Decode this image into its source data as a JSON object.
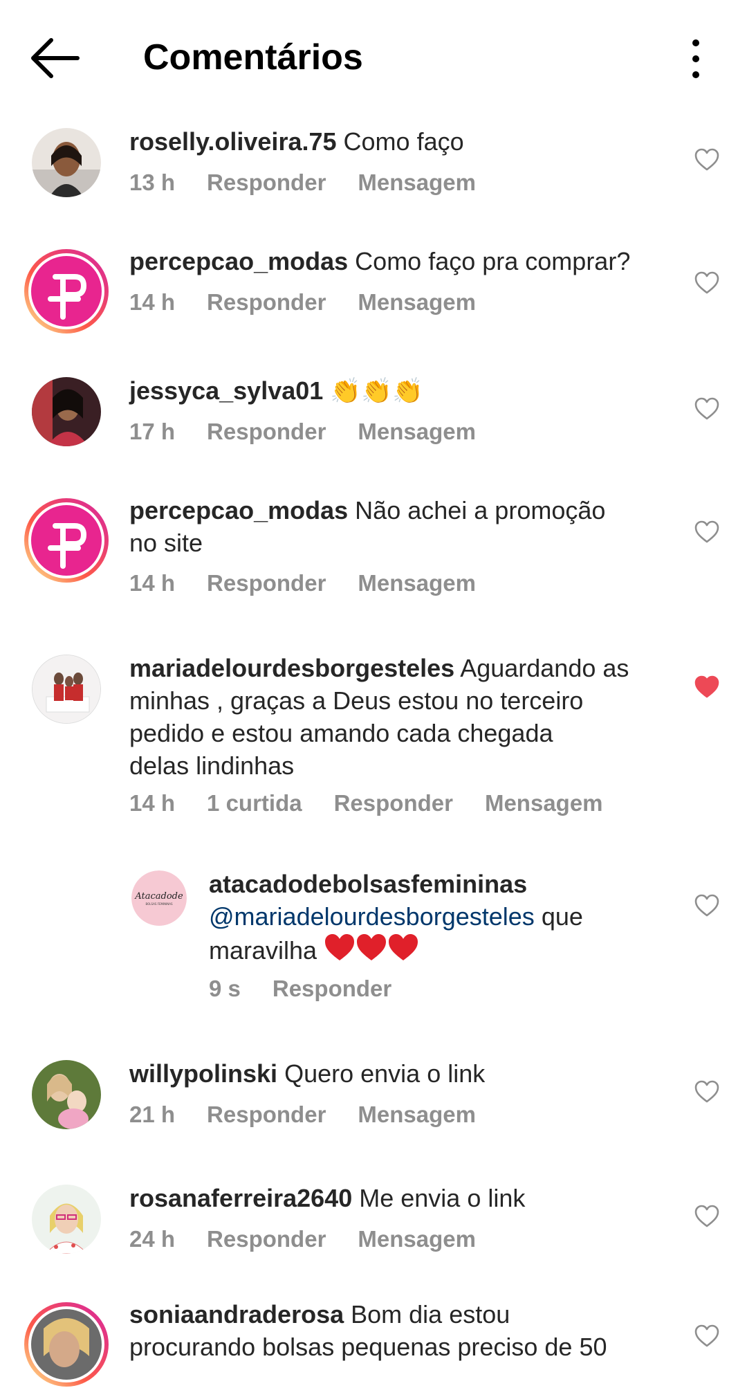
{
  "header": {
    "title": "Comentários"
  },
  "labels": {
    "reply": "Responder",
    "message": "Mensagem"
  },
  "comments": [
    {
      "username": "roselly.oliveira.75",
      "text": "Como faço",
      "time": "13 h",
      "liked": false
    },
    {
      "username": "percepcao_modas",
      "text": "Como faço pra comprar?",
      "time": "14 h",
      "liked": false
    },
    {
      "username": "jessyca_sylva01",
      "text": "👏👏👏",
      "time": "17 h",
      "liked": false
    },
    {
      "username": "percepcao_modas",
      "text_line1": "Não achei a promoção",
      "text_line2": "no site",
      "time": "14 h",
      "liked": false
    },
    {
      "username": "mariadelourdesborgesteles",
      "text_line1": "Aguardando as",
      "text_line2": "minhas , graças a Deus estou no terceiro",
      "text_line3": "pedido e estou amando cada chegada",
      "text_line4": "delas lindinhas",
      "time": "14 h",
      "likes": "1 curtida",
      "liked": true
    },
    {
      "username": "atacadodebolsasfemininas",
      "mention": "@mariadelourdesborgesteles",
      "text_after_mention": "que",
      "text_line3": "maravilha",
      "time": "9 s",
      "is_reply": true,
      "avatar_text": "Atacadode",
      "avatar_subtext": "BOLSAS FEMININAS",
      "liked": false
    },
    {
      "username": "willypolinski",
      "text": "Quero envia o link",
      "time": "21 h",
      "liked": false
    },
    {
      "username": "rosanaferreira2640",
      "text": "Me envia o link",
      "time": "24 h",
      "liked": false
    },
    {
      "username": "soniaandraderosa",
      "text_line1": "Bom dia estou",
      "text_line2": "procurando bolsas pequenas preciso de 50",
      "liked": false
    }
  ],
  "colors": {
    "like_red": "#ed4956",
    "mention": "#00376b",
    "meta_gray": "#8e8e8e",
    "brand_pink": "#e8258f"
  }
}
